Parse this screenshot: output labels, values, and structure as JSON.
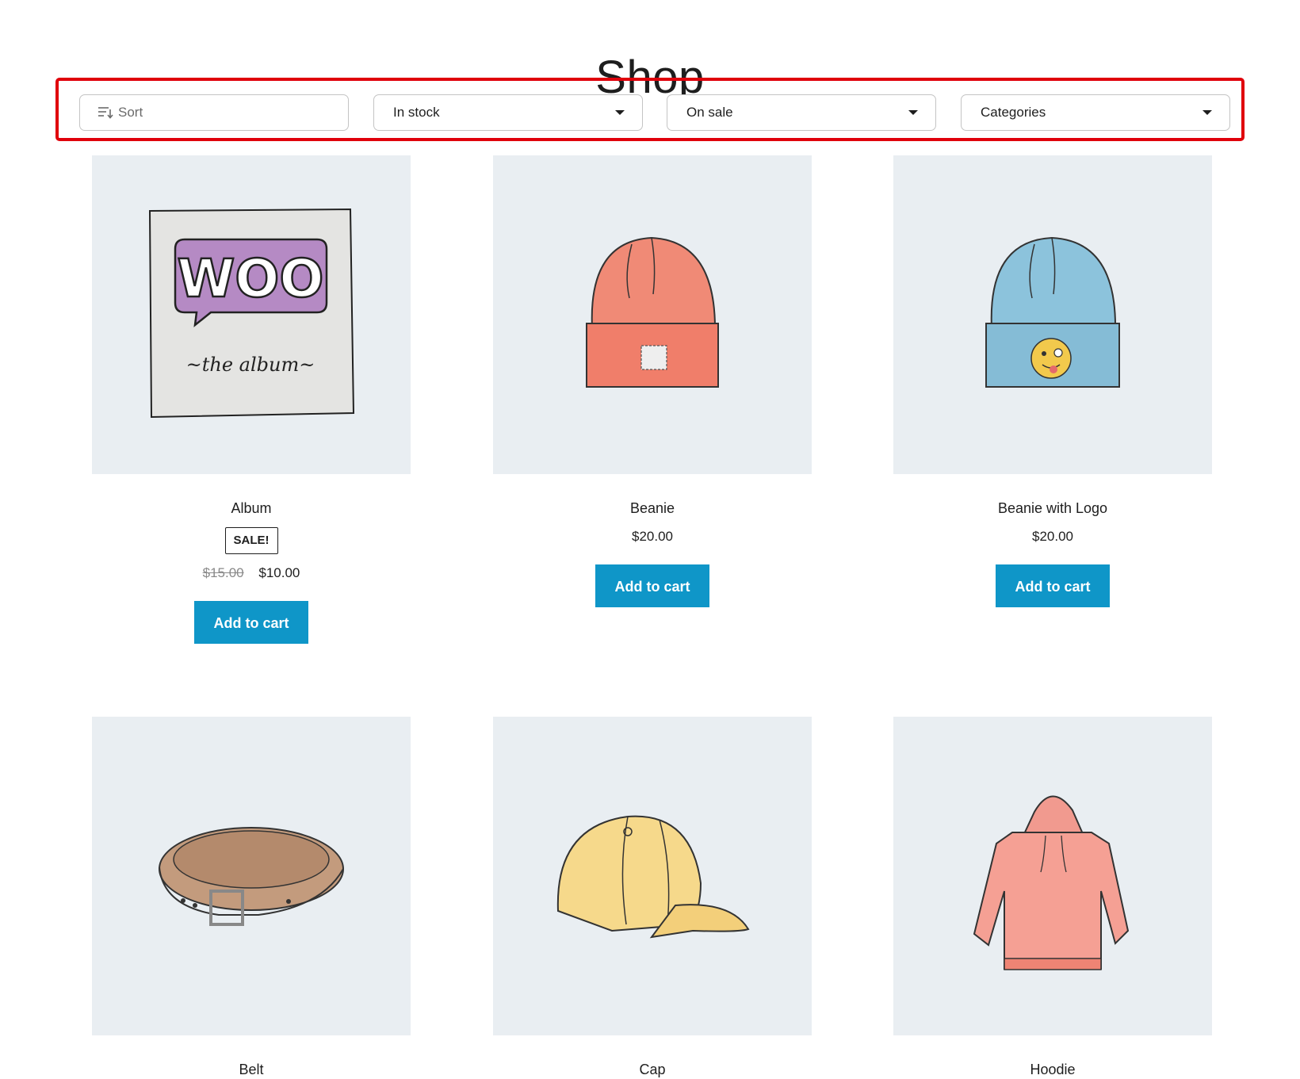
{
  "page": {
    "title": "Shop"
  },
  "filters": {
    "sort": {
      "label": "Sort",
      "icon": "sort-icon"
    },
    "stock": {
      "label": "In stock",
      "icon": "caret-down-icon"
    },
    "sale": {
      "label": "On sale",
      "icon": "caret-down-icon"
    },
    "categories": {
      "label": "Categories",
      "icon": "caret-down-icon"
    }
  },
  "colors": {
    "accent": "#0f96c8",
    "highlight_frame": "#e0000b",
    "image_background": "#e9eef2"
  },
  "products": [
    {
      "name": "Album",
      "badge": "SALE!",
      "old_price": "$15.00",
      "price": "$10.00",
      "button": "Add to cart",
      "image": "woo-album-image"
    },
    {
      "name": "Beanie",
      "price": "$20.00",
      "button": "Add to cart",
      "image": "beanie-image"
    },
    {
      "name": "Beanie with Logo",
      "price": "$20.00",
      "button": "Add to cart",
      "image": "beanie-logo-image"
    },
    {
      "name": "Belt",
      "image": "belt-image"
    },
    {
      "name": "Cap",
      "image": "cap-image"
    },
    {
      "name": "Hoodie",
      "image": "hoodie-image"
    }
  ]
}
